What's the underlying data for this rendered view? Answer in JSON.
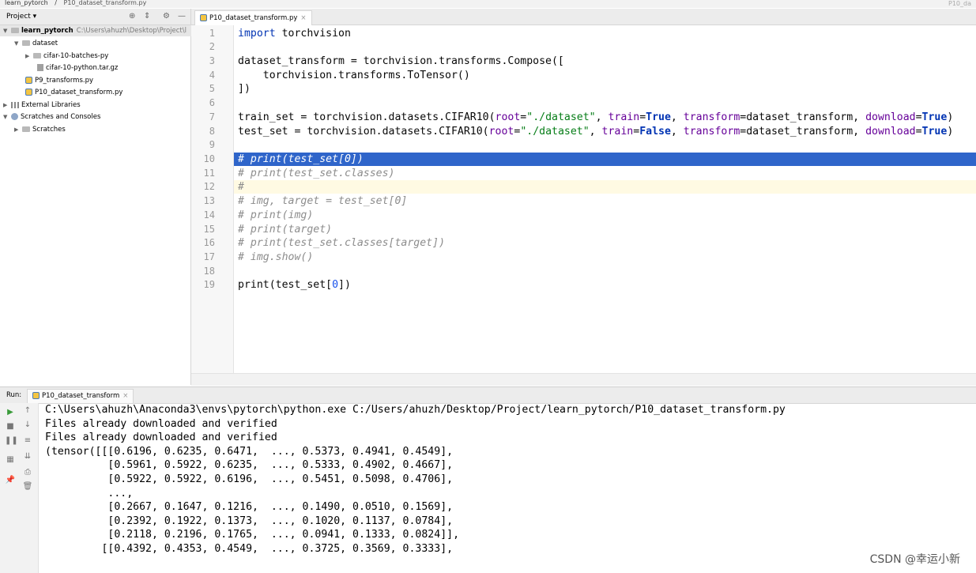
{
  "breadcrumb": {
    "project": "learn_pytorch",
    "file": "P10_dataset_transform.py"
  },
  "top_right_mark": "P10_da",
  "project_panel": {
    "title": "Project",
    "tree": [
      {
        "label": "learn_pytorch",
        "path": "C:\\Users\\ahuzh\\Desktop\\Project\\l",
        "type": "folder",
        "level": 0,
        "expanded": true
      },
      {
        "label": "dataset",
        "type": "folder",
        "level": 1,
        "expanded": true
      },
      {
        "label": "cifar-10-batches-py",
        "type": "folder",
        "level": 2,
        "expanded": false
      },
      {
        "label": "cifar-10-python.tar.gz",
        "type": "archive",
        "level": 2
      },
      {
        "label": "P9_transforms.py",
        "type": "py",
        "level": 1
      },
      {
        "label": "P10_dataset_transform.py",
        "type": "py",
        "level": 1
      },
      {
        "label": "External Libraries",
        "type": "libs",
        "level": 0,
        "expanded": false
      },
      {
        "label": "Scratches and Consoles",
        "type": "scratch",
        "level": 0,
        "expanded": true
      },
      {
        "label": "Scratches",
        "type": "folder",
        "level": 1,
        "expanded": false
      }
    ]
  },
  "editor": {
    "tab_label": "P10_dataset_transform.py",
    "line_numbers": [
      "1",
      "2",
      "3",
      "4",
      "5",
      "6",
      "7",
      "8",
      "9",
      "10",
      "11",
      "12",
      "13",
      "14",
      "15",
      "16",
      "17",
      "18",
      "19"
    ],
    "code": {
      "l1_kw": "import",
      "l1_rest": " torchvision",
      "l3": "dataset_transform = torchvision.transforms.Compose([",
      "l4": "    torchvision.transforms.ToTensor()",
      "l5": "])",
      "l7_a": "train_set = torchvision.datasets.CIFAR10(",
      "l7_root": "root",
      "l7_eq": "=",
      "l7_str": "\"./dataset\"",
      "l7_c1": ", ",
      "l7_train": "train",
      "l7_eq2": "=",
      "l7_true": "True",
      "l7_c2": ", ",
      "l7_transform": "transform",
      "l7_eq3": "=dataset_transform, ",
      "l7_download": "download",
      "l7_eq4": "=",
      "l7_true2": "True",
      "l7_end": ")",
      "l8_a": "test_set = torchvision.datasets.CIFAR10(",
      "l8_root": "root",
      "l8_eq": "=",
      "l8_str": "\"./dataset\"",
      "l8_c1": ", ",
      "l8_train": "train",
      "l8_eq2": "=",
      "l8_false": "False",
      "l8_c2": ", ",
      "l8_transform": "transform",
      "l8_eq3": "=dataset_transform, ",
      "l8_download": "download",
      "l8_eq4": "=",
      "l8_true2": "True",
      "l8_end": ")",
      "l10": "# print(test_set[0])",
      "l11": "# print(test_set.classes)",
      "l12": "#",
      "l13": "# img, target = test_set[0]",
      "l14": "# print(img)",
      "l15": "# print(target)",
      "l16": "# print(test_set.classes[target])",
      "l17": "# img.show()",
      "l19_a": "print(test_set[",
      "l19_num": "0",
      "l19_b": "])"
    }
  },
  "run_panel": {
    "label": "Run:",
    "tab_label": "P10_dataset_transform",
    "console_lines": [
      "C:\\Users\\ahuzh\\Anaconda3\\envs\\pytorch\\python.exe C:/Users/ahuzh/Desktop/Project/learn_pytorch/P10_dataset_transform.py",
      "Files already downloaded and verified",
      "Files already downloaded and verified",
      "(tensor([[[0.6196, 0.6235, 0.6471,  ..., 0.5373, 0.4941, 0.4549],",
      "          [0.5961, 0.5922, 0.6235,  ..., 0.5333, 0.4902, 0.4667],",
      "          [0.5922, 0.5922, 0.6196,  ..., 0.5451, 0.5098, 0.4706],",
      "          ...,",
      "          [0.2667, 0.1647, 0.1216,  ..., 0.1490, 0.0510, 0.1569],",
      "          [0.2392, 0.1922, 0.1373,  ..., 0.1020, 0.1137, 0.0784],",
      "          [0.2118, 0.2196, 0.1765,  ..., 0.0941, 0.1333, 0.0824]],",
      "",
      "         [[0.4392, 0.4353, 0.4549,  ..., 0.3725, 0.3569, 0.3333],"
    ]
  },
  "watermark": "CSDN @幸运小新"
}
